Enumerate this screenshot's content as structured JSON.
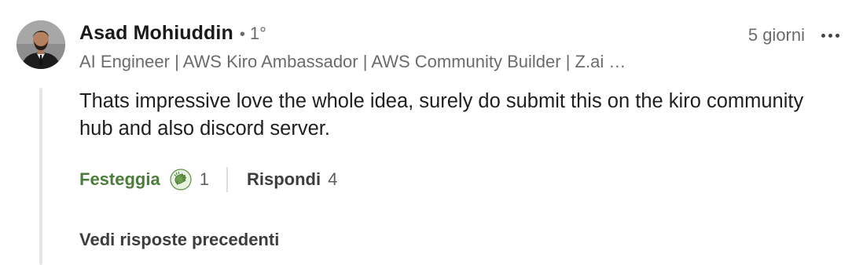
{
  "comment": {
    "author": {
      "name": "Asad Mohiuddin",
      "separator": "•",
      "degree": "1°",
      "headline": "AI Engineer | AWS Kiro Ambassador | AWS Community Builder | Z.ai …"
    },
    "time": "5 giorni",
    "more_icon": "ellipsis-icon",
    "text": "Thats impressive love the whole idea, surely do submit this on the kiro community hub and also discord server."
  },
  "actions": {
    "celebrate_label": "Festeggia",
    "reaction_icon": "celebrate-reaction-icon",
    "reaction_count": "1",
    "reply_label": "Rispondi",
    "reply_count": "4"
  },
  "replies": {
    "view_previous_label": "Vedi risposte precedenti"
  },
  "colors": {
    "celebrate_green": "#4a7d39",
    "muted_text": "#6b6b6b",
    "thread_line": "#e6e6e6"
  }
}
